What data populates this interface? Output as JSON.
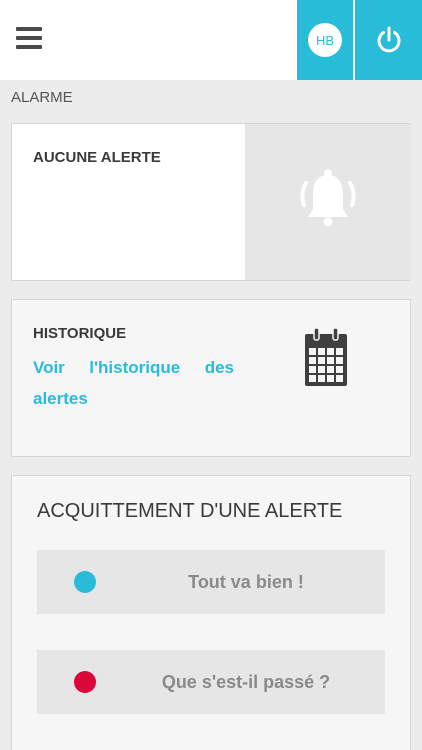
{
  "header": {
    "menu_icon": "hamburger-menu-icon",
    "user_initials": "HB",
    "power_icon": "power-icon",
    "accent_color": "#29bcd8"
  },
  "section": {
    "title": "ALARME"
  },
  "alarm_card": {
    "status": "AUCUNE ALERTE",
    "icon": "bell-icon"
  },
  "history_card": {
    "title": "HISTORIQUE",
    "link": "Voir l'historique des alertes",
    "icon": "calendar-icon"
  },
  "ack_card": {
    "title": "ACQUITTEMENT D'UNE ALERTE",
    "options": [
      {
        "label": "Tout va bien !",
        "color": "#29bcd8"
      },
      {
        "label": "Que s'est-il passé ?",
        "color": "#d9073a"
      }
    ]
  }
}
